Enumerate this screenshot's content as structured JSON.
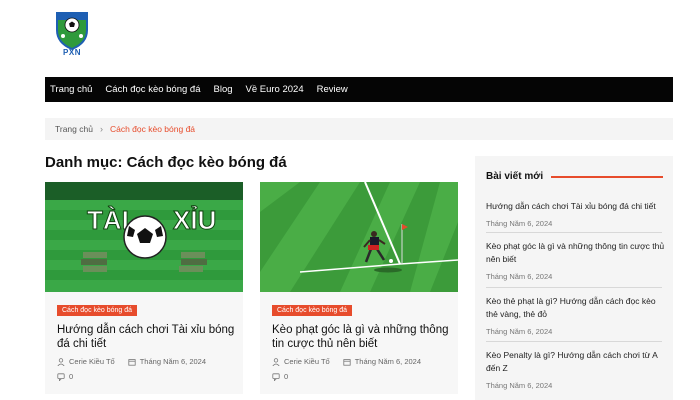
{
  "logo": {
    "text": "PXN"
  },
  "nav": {
    "items": [
      "Trang chủ",
      "Cách đọc kèo bóng đá",
      "Blog",
      "Về Euro 2024",
      "Review"
    ]
  },
  "breadcrumb": {
    "home": "Trang chủ",
    "separator": "›",
    "current": "Cách đọc kèo bóng đá"
  },
  "page": {
    "title": "Danh mục: Cách đọc kèo bóng đá"
  },
  "cards": [
    {
      "image_text_left": "TÀI",
      "image_text_right": "XỈU",
      "category": "Cách đọc kèo bóng đá",
      "title": "Hướng dẫn cách chơi Tài xỉu bóng đá chi tiết",
      "author": "Cerie Kiều Tố",
      "date": "Tháng Năm 6, 2024",
      "comments": "0"
    },
    {
      "category": "Cách đọc kèo bóng đá",
      "title": "Kèo phạt góc là gì và những thông tin cược thủ nên biết",
      "author": "Cerie Kiều Tố",
      "date": "Tháng Năm 6, 2024",
      "comments": "0"
    }
  ],
  "sidebar": {
    "title": "Bài viết mới",
    "posts": [
      {
        "title": "Hướng dẫn cách chơi Tài xỉu bóng đá chi tiết",
        "date": "Tháng Năm 6, 2024"
      },
      {
        "title": "Kèo phạt góc là gì và những thông tin cược thủ nên biết",
        "date": "Tháng Năm 6, 2024"
      },
      {
        "title": "Kèo thẻ phạt là gì? Hướng dẫn cách đọc kèo thẻ vàng, thẻ đỏ",
        "date": "Tháng Năm 6, 2024"
      },
      {
        "title": "Kèo Penalty là gì? Hướng dẫn cách chơi từ A đến Z",
        "date": "Tháng Năm 6, 2024"
      }
    ]
  },
  "colors": {
    "accent": "#e74c2c",
    "nav_bg": "#050505",
    "logo_blue": "#1e5fb3",
    "field_green": "#2f9a3c"
  },
  "icons": {
    "author": "user-icon",
    "date": "calendar-icon",
    "comments": "comment-icon",
    "breadcrumb_sep": "chevron-right-icon"
  }
}
